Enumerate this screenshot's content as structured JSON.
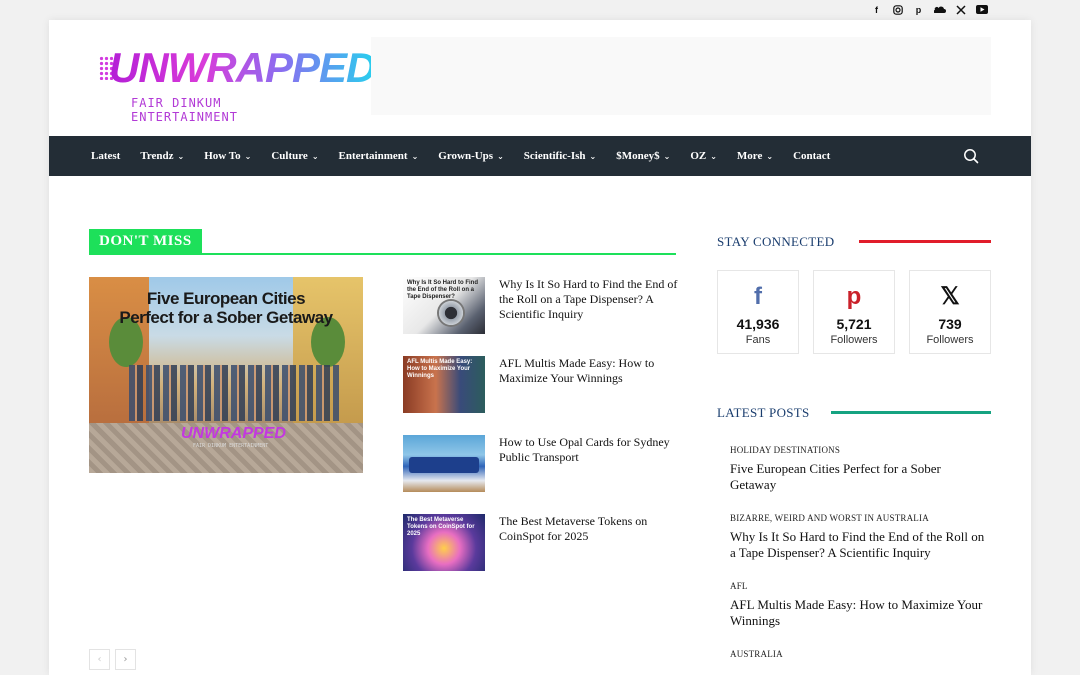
{
  "top_social": [
    "facebook-icon",
    "instagram-icon",
    "pinterest-icon",
    "soundcloud-icon",
    "x-icon",
    "youtube-icon"
  ],
  "logo": {
    "main": "UNWRAPPED",
    "sub": "FAIR DINKUM ENTERTAINMENT"
  },
  "nav": {
    "items": [
      {
        "label": "Latest",
        "dropdown": false
      },
      {
        "label": "Trendz",
        "dropdown": true
      },
      {
        "label": "How To",
        "dropdown": true
      },
      {
        "label": "Culture",
        "dropdown": true
      },
      {
        "label": "Entertainment",
        "dropdown": true
      },
      {
        "label": "Grown-Ups",
        "dropdown": true
      },
      {
        "label": "Scientific-Ish",
        "dropdown": true
      },
      {
        "label": "$Money$",
        "dropdown": true
      },
      {
        "label": "OZ",
        "dropdown": true
      },
      {
        "label": "More",
        "dropdown": true
      },
      {
        "label": "Contact",
        "dropdown": false
      }
    ],
    "chevron": "⌄"
  },
  "dont_miss": {
    "label": "DON'T MISS",
    "hero": {
      "title_lines": "Five European Cities Perfect for a Sober Getaway",
      "logo": "UNWRAPPED",
      "logo_sub": "FAIR DINKUM ENTERTAINMENT"
    },
    "posts": [
      {
        "title": "Why Is It So Hard to Find the End of the Roll on a Tape Dispenser? A Scientific Inquiry",
        "thumb_caption": "Why Is It So Hard to Find the End of the Roll on a Tape Dispenser?"
      },
      {
        "title": "AFL Multis Made Easy: How to Maximize Your Winnings",
        "thumb_caption": "AFL Multis Made Easy: How to Maximize Your Winnings"
      },
      {
        "title": "How to Use Opal Cards for Sydney Public Transport",
        "thumb_caption": ""
      },
      {
        "title": "The Best Metaverse Tokens on CoinSpot for 2025",
        "thumb_caption": "The Best Metaverse Tokens on CoinSpot for 2025"
      }
    ],
    "pager": {
      "prev": "‹",
      "next": "›"
    }
  },
  "stay_connected": {
    "title": "STAY CONNECTED",
    "items": [
      {
        "icon": "facebook-icon",
        "glyph": "f",
        "color": "#516eab",
        "count": "41,936",
        "label": "Fans"
      },
      {
        "icon": "pinterest-icon",
        "glyph": "p",
        "color": "#ca212a",
        "count": "5,721",
        "label": "Followers"
      },
      {
        "icon": "x-icon",
        "glyph": "𝕏",
        "color": "#111111",
        "count": "739",
        "label": "Followers"
      }
    ]
  },
  "latest_posts": {
    "title": "LATEST POSTS",
    "items": [
      {
        "category": "HOLIDAY DESTINATIONS",
        "title": "Five European Cities Perfect for a Sober Getaway"
      },
      {
        "category": "BIZARRE, WEIRD AND WORST IN AUSTRALIA",
        "title": "Why Is It So Hard to Find the End of the Roll on a Tape Dispenser? A Scientific Inquiry"
      },
      {
        "category": "AFL",
        "title": "AFL Multis Made Easy: How to Maximize Your Winnings"
      },
      {
        "category": "AUSTRALIA",
        "title": ""
      }
    ]
  }
}
